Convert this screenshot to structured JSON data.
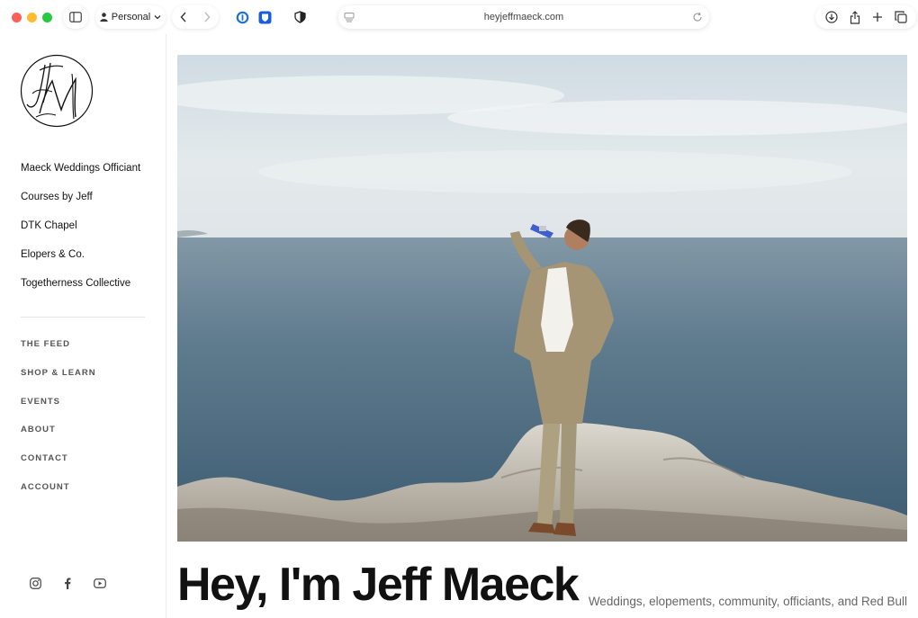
{
  "browser": {
    "profile_label": "Personal",
    "url": "heyjeffmaeck.com"
  },
  "sidebar": {
    "brands": [
      {
        "label": "Maeck Weddings Officiant"
      },
      {
        "label": "Courses by Jeff"
      },
      {
        "label": "DTK Chapel"
      },
      {
        "label": "Elopers & Co."
      },
      {
        "label": "Togetherness Collective"
      }
    ],
    "menu": [
      {
        "label": "THE FEED"
      },
      {
        "label": "SHOP & LEARN"
      },
      {
        "label": "EVENTS"
      },
      {
        "label": "ABOUT"
      },
      {
        "label": "CONTACT"
      },
      {
        "label": "ACCOUNT"
      }
    ],
    "socials": [
      "instagram-icon",
      "facebook-icon",
      "youtube-icon"
    ]
  },
  "main": {
    "headline": "Hey, I'm Jeff Maeck",
    "tagline": "Weddings, elopements, community, officiants, and Red Bull"
  },
  "colors": {
    "sky": "#dfe6ea",
    "sea": "#4a6a82",
    "suit": "#a89a7c"
  }
}
